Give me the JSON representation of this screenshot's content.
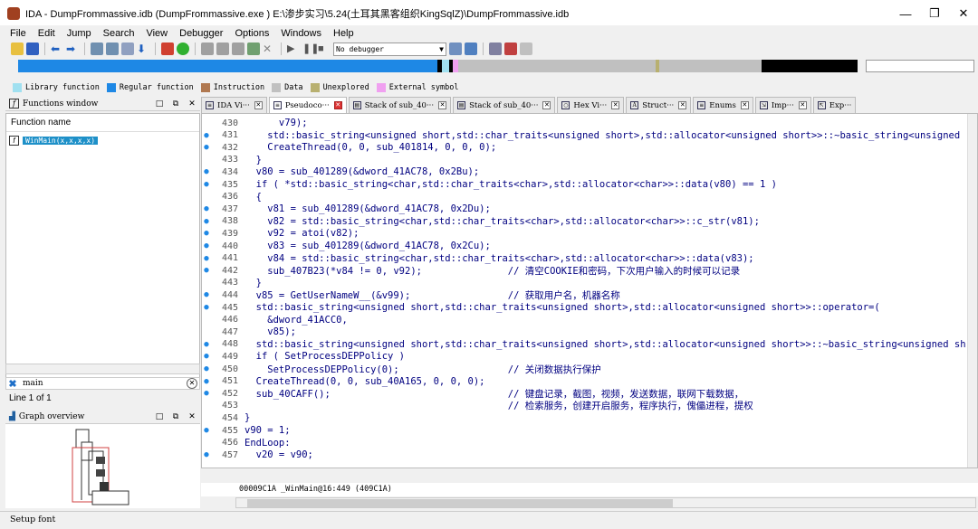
{
  "window": {
    "title": "IDA - DumpFrommassive.idb (DumpFrommassive.exe ) E:\\渗步实习\\5.24(土耳其黑客组织KingSqlZ)\\DumpFrommassive.idb"
  },
  "menu": [
    "File",
    "Edit",
    "Jump",
    "Search",
    "View",
    "Debugger",
    "Options",
    "Windows",
    "Help"
  ],
  "toolbar": {
    "debugger_select": "No debugger"
  },
  "legend": [
    {
      "label": "Library function",
      "color": "#a0e0f0"
    },
    {
      "label": "Regular function",
      "color": "#1e88e5"
    },
    {
      "label": "Instruction",
      "color": "#b07850"
    },
    {
      "label": "Data",
      "color": "#c0c0c0"
    },
    {
      "label": "Unexplored",
      "color": "#b8b070"
    },
    {
      "label": "External symbol",
      "color": "#f0a0f0"
    }
  ],
  "functions_window": {
    "title": "Functions window",
    "column_header": "Function name",
    "selected_function": "WinMain(x,x,x,x)",
    "search_value": "main",
    "line_count": "Line 1 of 1"
  },
  "graph_overview": {
    "title": "Graph overview"
  },
  "tabs": [
    {
      "label": "IDA Vi···",
      "active": false
    },
    {
      "label": "Pseudoco···",
      "active": true
    },
    {
      "label": "Stack of sub_40···",
      "active": false
    },
    {
      "label": "Stack of sub_40···",
      "active": false
    },
    {
      "label": "Hex Vi···",
      "active": false
    },
    {
      "label": "Struct···",
      "active": false
    },
    {
      "label": "Enums",
      "active": false
    },
    {
      "label": "Imp···",
      "active": false
    },
    {
      "label": "Exp···",
      "active": false
    }
  ],
  "code_lines": [
    {
      "n": "430",
      "dot": false,
      "text": "      v79);"
    },
    {
      "n": "431",
      "dot": true,
      "text": "    std::basic_string<unsigned short,std::char_traits<unsigned short>,std::allocator<unsigned short>>::~basic_string<unsigned"
    },
    {
      "n": "432",
      "dot": true,
      "text": "    CreateThread(0, 0, sub_401814, 0, 0, 0);"
    },
    {
      "n": "433",
      "dot": false,
      "text": "  }"
    },
    {
      "n": "434",
      "dot": true,
      "text": "  v80 = sub_401289(&dword_41AC78, 0x2Bu);"
    },
    {
      "n": "435",
      "dot": true,
      "text": "  if ( *std::basic_string<char,std::char_traits<char>,std::allocator<char>>::data(v80) == 1 )"
    },
    {
      "n": "436",
      "dot": false,
      "text": "  {"
    },
    {
      "n": "437",
      "dot": true,
      "text": "    v81 = sub_401289(&dword_41AC78, 0x2Du);"
    },
    {
      "n": "438",
      "dot": true,
      "text": "    v82 = std::basic_string<char,std::char_traits<char>,std::allocator<char>>::c_str(v81);"
    },
    {
      "n": "439",
      "dot": true,
      "text": "    v92 = atoi(v82);"
    },
    {
      "n": "440",
      "dot": true,
      "text": "    v83 = sub_401289(&dword_41AC78, 0x2Cu);"
    },
    {
      "n": "441",
      "dot": true,
      "text": "    v84 = std::basic_string<char,std::char_traits<char>,std::allocator<char>>::data(v83);"
    },
    {
      "n": "442",
      "dot": true,
      "text": "    sub_407B23(*v84 != 0, v92);               // 清空COOKIE和密码，下次用户输入的时候可以记录"
    },
    {
      "n": "443",
      "dot": false,
      "text": "  }"
    },
    {
      "n": "444",
      "dot": true,
      "text": "  v85 = GetUserNameW__(&v99);                 // 获取用户名，机器名称"
    },
    {
      "n": "445",
      "dot": true,
      "text": "  std::basic_string<unsigned short,std::char_traits<unsigned short>,std::allocator<unsigned short>>::operator=("
    },
    {
      "n": "446",
      "dot": false,
      "text": "    &dword_41ACC0,"
    },
    {
      "n": "447",
      "dot": false,
      "text": "    v85);"
    },
    {
      "n": "448",
      "dot": true,
      "text": "  std::basic_string<unsigned short,std::char_traits<unsigned short>,std::allocator<unsigned short>>::~basic_string<unsigned sh"
    },
    {
      "n": "449",
      "dot": true,
      "text": "  if ( SetProcessDEPPolicy )"
    },
    {
      "n": "450",
      "dot": true,
      "text": "    SetProcessDEPPolicy(0);                   // 关闭数据执行保护"
    },
    {
      "n": "451",
      "dot": true,
      "text": "  CreateThread(0, 0, sub_40A165, 0, 0, 0);"
    },
    {
      "n": "452",
      "dot": true,
      "text": "  sub_40CAFF();                               // 键盘记录，截图，视频，发送数据，联网下载数据，"
    },
    {
      "n": "453",
      "dot": false,
      "text": "                                              // 检索服务，创建开启服务，程序执行，傀儡进程，提权"
    },
    {
      "n": "454",
      "dot": false,
      "text": "}"
    },
    {
      "n": "455",
      "dot": true,
      "text": "v90 = 1;"
    },
    {
      "n": "456",
      "dot": false,
      "text": "EndLoop:"
    },
    {
      "n": "457",
      "dot": true,
      "text": "  v20 = v90;"
    }
  ],
  "status_line": "00009C1A _WinMain@16:449 (409C1A)",
  "bottom_status": "Setup font"
}
